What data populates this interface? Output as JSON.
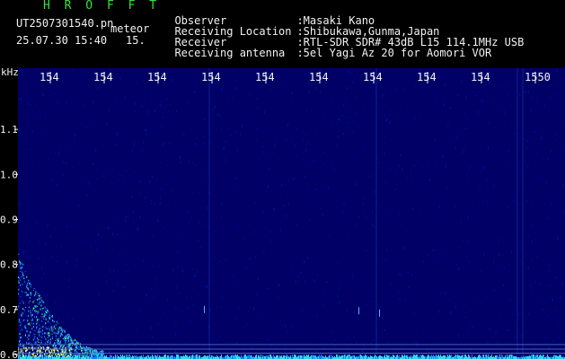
{
  "header": {
    "station": "H R O F F T",
    "filename": "UT2507301540.pn",
    "mode": "meteor",
    "datetime": "25.07.30 15:40",
    "value": "15.",
    "info": [
      {
        "label": "Observer",
        "value": ":Masaki Kano"
      },
      {
        "label": "Receiving Location",
        "value": ":Shibukawa,Gunma,Japan"
      },
      {
        "label": "Receiver",
        "value": ":RTL-SDR SDR# 43dB L15 114.1MHz USB"
      },
      {
        "label": "Receiving antenna",
        "value": ":5el Yagi Az 20 for Aomori VOR"
      }
    ]
  },
  "chart_data": {
    "type": "heatmap",
    "ylabel": "kHz",
    "y_ticks": [
      "1.1",
      "1.0",
      "0.9",
      "0.8",
      "0.7",
      "0.6"
    ],
    "y_tick_values": [
      1.1,
      1.0,
      0.9,
      0.8,
      0.7,
      0.6
    ],
    "ylim": [
      0.59,
      1.2
    ],
    "x_ticks": [
      "154",
      "154",
      "154",
      "154",
      "154",
      "154",
      "154",
      "154",
      "154",
      "1550"
    ],
    "colors": {
      "background": "#000066",
      "text": "#f2f2f2",
      "accent": "#34e23a"
    }
  }
}
